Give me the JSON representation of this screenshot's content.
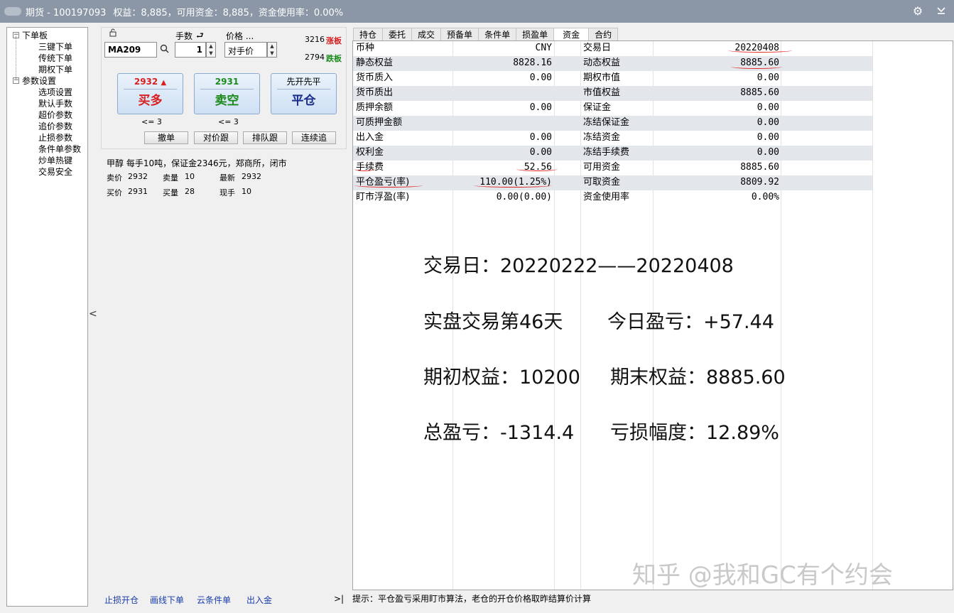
{
  "titlebar": {
    "app_name": "期货 - 100197093",
    "summary": "权益：8,885，可用资金：8,885，资金使用率：0.00%"
  },
  "tree": {
    "groups": [
      {
        "label": "下单板",
        "children": [
          "三键下单",
          "传统下单",
          "期权下单"
        ]
      },
      {
        "label": "参数设置",
        "children": [
          "选项设置",
          "默认手数",
          "超价参数",
          "追价参数",
          "止损参数",
          "条件单参数",
          "炒单热键",
          "交易安全"
        ]
      }
    ]
  },
  "order": {
    "qty_label": "手数",
    "price_label": "价格 ...",
    "contract": "MA209",
    "qty": "1",
    "price_mode": "对手价",
    "limit_up": "3216",
    "limit_up_label": "涨板",
    "limit_down": "2794",
    "limit_down_label": "跌板",
    "buy_price": "2932",
    "buy_label": "买多",
    "sell_price": "2931",
    "sell_label": "卖空",
    "close_top": "先开先平",
    "close_label": "平仓",
    "buy_limit": "<= 3",
    "sell_limit": "<= 3",
    "buttons": [
      "撤单",
      "对价跟",
      "排队跟",
      "连续追"
    ]
  },
  "quote": {
    "info": "甲醇  每手10吨，保证金2346元，郑商所，闭市",
    "ask_label": "卖价",
    "ask": "2932",
    "ask_vol_label": "卖量",
    "ask_vol": "10",
    "last_label": "最新",
    "last": "2932",
    "bid_label": "买价",
    "bid": "2931",
    "bid_vol_label": "买量",
    "bid_vol": "28",
    "cur_vol_label": "现手",
    "cur_vol": "10"
  },
  "bottom_links": [
    "止损开仓",
    "画线下单",
    "云条件单",
    "出入金"
  ],
  "bottom_arrow": ">|",
  "tabs": [
    "持仓",
    "委托",
    "成交",
    "预备单",
    "条件单",
    "损盈单",
    "资金",
    "合约"
  ],
  "funds": [
    {
      "k1": "币种",
      "v1": "CNY",
      "k2": "交易日",
      "v2": "20220408"
    },
    {
      "k1": "静态权益",
      "v1": "8828.16",
      "k2": "动态权益",
      "v2": "8885.60"
    },
    {
      "k1": "货币质入",
      "v1": "0.00",
      "k2": "期权市值",
      "v2": "0.00"
    },
    {
      "k1": "货币质出",
      "v1": "",
      "k2": "市值权益",
      "v2": "8885.60"
    },
    {
      "k1": "质押余额",
      "v1": "0.00",
      "k2": "保证金",
      "v2": "0.00"
    },
    {
      "k1": "可质押金额",
      "v1": "",
      "k2": "冻结保证金",
      "v2": "0.00"
    },
    {
      "k1": "出入金",
      "v1": "0.00",
      "k2": "冻结资金",
      "v2": "0.00"
    },
    {
      "k1": "权利金",
      "v1": "0.00",
      "k2": "冻结手续费",
      "v2": "0.00"
    },
    {
      "k1": "手续费",
      "v1": "52.56",
      "k2": "可用资金",
      "v2": "8885.60"
    },
    {
      "k1": "平仓盈亏(率)",
      "v1": "110.00(1.25%)",
      "k2": "可取资金",
      "v2": "8809.92"
    },
    {
      "k1": "盯市浮盈(率)",
      "v1": "0.00(0.00)",
      "k2": "资金使用率",
      "v2": "0.00%"
    }
  ],
  "overlay": {
    "line1": "交易日：20220222——20220408",
    "line2a": "实盘交易第46天",
    "line2b": "今日盈亏：+57.44",
    "line3a": "期初权益：10200",
    "line3b": "期末权益：8885.60",
    "line4a": "总盈亏：-1314.4",
    "line4b": "亏损幅度：12.89%"
  },
  "watermark": "知乎 @我和GC有个约会",
  "status": "提示：平仓盈亏采用盯市算法，老仓的开仓价格取昨结算价计算",
  "colors": {
    "titlebar": "#8b97a6",
    "buy": "#d81e1e",
    "sell": "#1a8a1a",
    "limit_up": "#d81e1e",
    "limit_down": "#1a8a1a",
    "link": "#1a3da8"
  }
}
